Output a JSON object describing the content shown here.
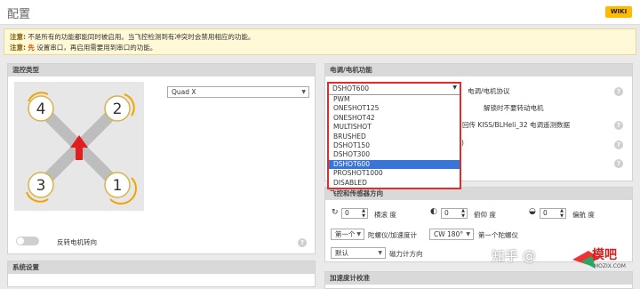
{
  "page": {
    "title": "配置",
    "wiki": "WIKI"
  },
  "notice": {
    "line1_prefix": "注意:",
    "line1": "不是所有的功能都能同时被启用。当飞控检测到有冲突时会禁用相应的功能。",
    "line2_prefix": "注意:",
    "line2_accent": "先",
    "line2": "设置串口，再启用需要用到串口的功能。"
  },
  "mixer": {
    "header": "混控类型",
    "selected": "Quad X",
    "motors": [
      "4",
      "2",
      "3",
      "1"
    ],
    "reverse_label": "反转电机转向"
  },
  "system": {
    "header": "系统设置"
  },
  "esc": {
    "header": "电调/电机功能",
    "protocol_label": "电调/电机协议",
    "idle_label": "解锁时不要转动电机",
    "telemetry_label": "回传 KISS/BLHeli_32 电调遥测数据",
    "paren": ")",
    "selected": "DSHOT600",
    "options": [
      "PWM",
      "ONESHOT125",
      "ONESHOT42",
      "MULTISHOT",
      "BRUSHED",
      "DSHOT150",
      "DSHOT300",
      "DSHOT600",
      "PROSHOT1000",
      "DISABLED"
    ]
  },
  "board": {
    "header": "飞控和传感器方向",
    "roll": "0",
    "roll_label": "横滚 度",
    "pitch": "0",
    "pitch_label": "俯仰 度",
    "yaw": "0",
    "yaw_label": "偏航 度",
    "gyro_select": "第一个",
    "gyro_label": "陀螺仪/加速度计",
    "align_select": "CW 180°",
    "align_label": "第一个陀螺仪",
    "mag_select": "默认",
    "mag_label": "磁力计方向"
  },
  "accel": {
    "header": "加速度计校准"
  },
  "watermark": {
    "text": "知乎 @",
    "logo": "模吧",
    "site": "MOZIX.COM"
  }
}
